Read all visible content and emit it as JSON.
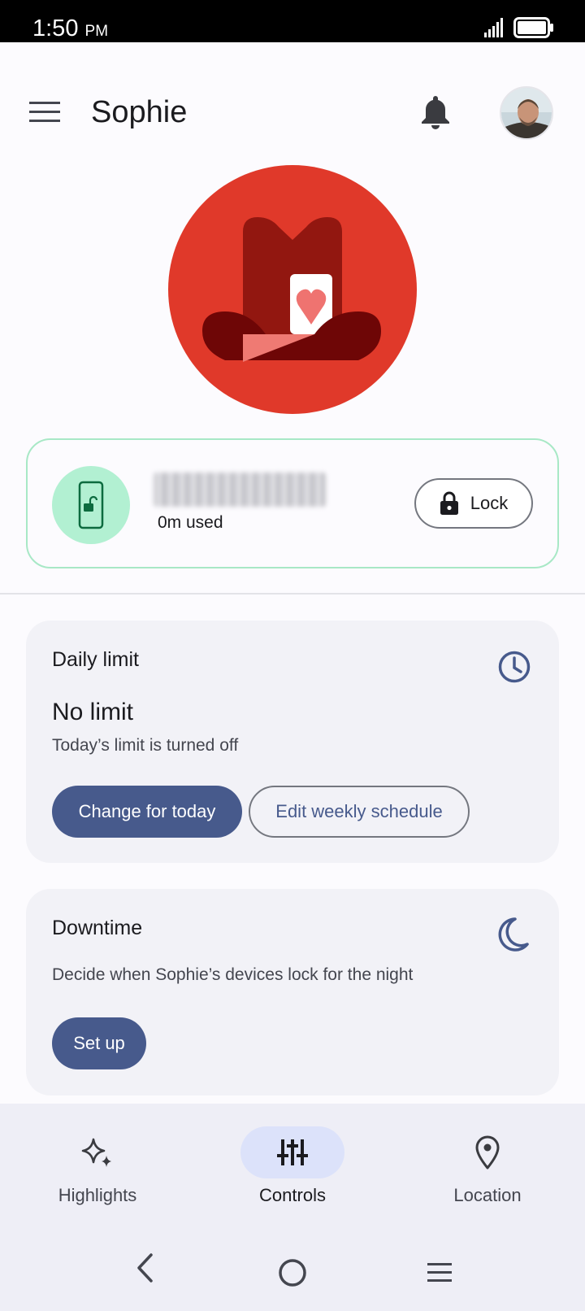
{
  "status_bar": {
    "time": "1:50",
    "ampm": "PM"
  },
  "header": {
    "title": "Sophie"
  },
  "device": {
    "usage": "0m used",
    "lock_label": "Lock"
  },
  "daily_limit": {
    "title": "Daily limit",
    "value": "No limit",
    "subtitle": "Today’s limit is turned off",
    "change_button": "Change for today",
    "edit_button": "Edit weekly schedule"
  },
  "downtime": {
    "title": "Downtime",
    "description": "Decide when Sophie’s devices lock for the night",
    "setup_button": "Set up"
  },
  "bottom_nav": {
    "items": [
      {
        "label": "Highlights",
        "icon": "sparkle-icon",
        "active": false
      },
      {
        "label": "Controls",
        "icon": "sliders-icon",
        "active": true
      },
      {
        "label": "Location",
        "icon": "location-pin-icon",
        "active": false
      }
    ]
  },
  "colors": {
    "primary": "#475a8c",
    "hero_red": "#e0392a",
    "device_green": "#b2f0d2",
    "card_bg": "#f2f2f7"
  }
}
